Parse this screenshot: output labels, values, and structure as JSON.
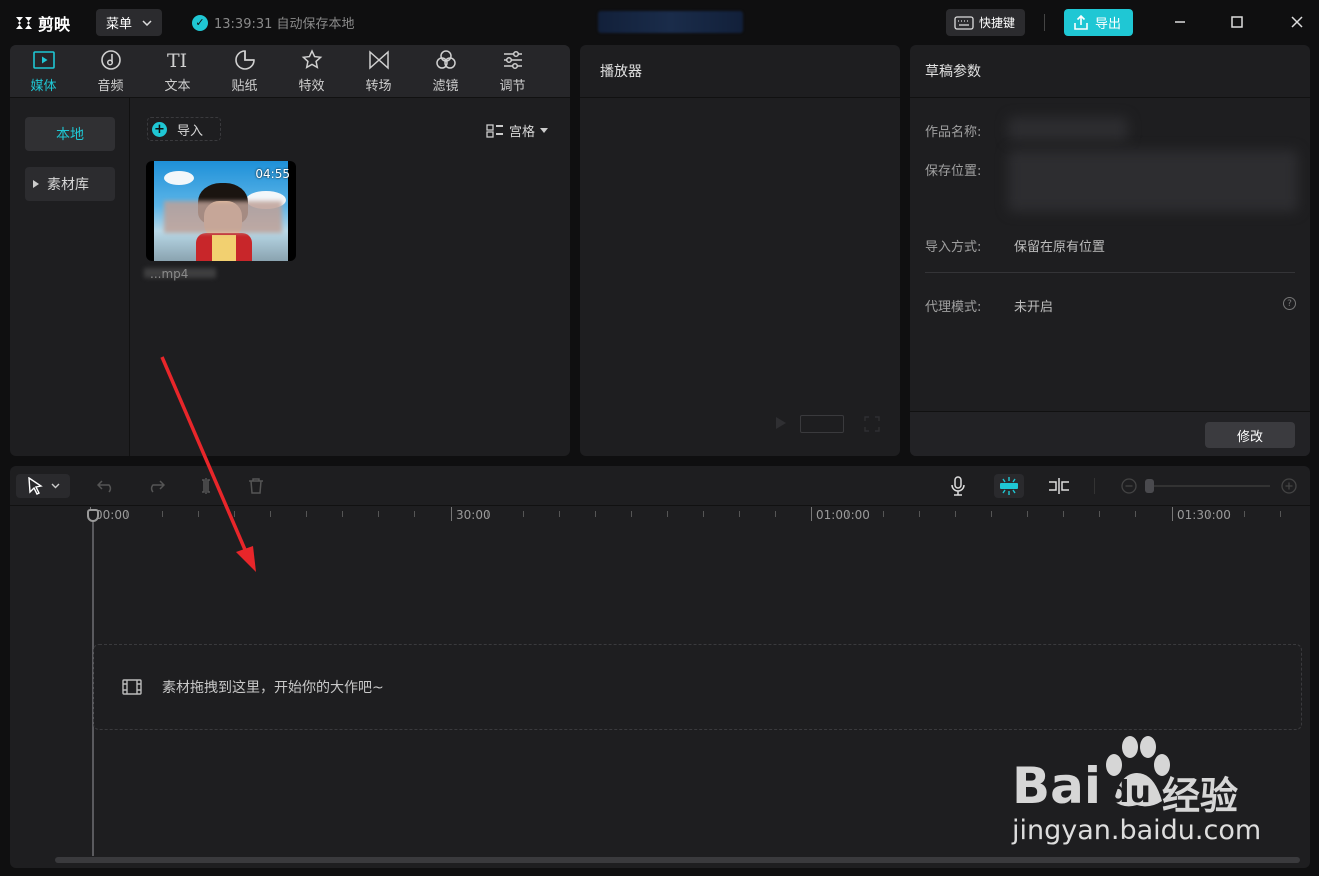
{
  "titlebar": {
    "app_name": "剪映",
    "menu_label": "菜单",
    "autosave_text": "13:39:31 自动保存本地",
    "shortcut_label": "快捷键",
    "export_label": "导出"
  },
  "media": {
    "tabs": [
      {
        "label": "媒体",
        "icon": "media-icon",
        "active": true
      },
      {
        "label": "音频",
        "icon": "audio-icon",
        "active": false
      },
      {
        "label": "文本",
        "icon": "text-icon",
        "active": false
      },
      {
        "label": "贴纸",
        "icon": "sticker-icon",
        "active": false
      },
      {
        "label": "特效",
        "icon": "effects-icon",
        "active": false
      },
      {
        "label": "转场",
        "icon": "transition-icon",
        "active": false
      },
      {
        "label": "滤镜",
        "icon": "filter-icon",
        "active": false
      },
      {
        "label": "调节",
        "icon": "adjust-icon",
        "active": false
      }
    ],
    "sidebar": [
      {
        "label": "本地",
        "active": true
      },
      {
        "label": "素材库",
        "active": false
      }
    ],
    "import_label": "导入",
    "view_label": "宫格",
    "clip": {
      "duration": "04:55",
      "name": "...mp4"
    }
  },
  "player": {
    "title": "播放器"
  },
  "draft": {
    "title": "草稿参数",
    "fields": [
      {
        "label": "作品名称:",
        "value": ""
      },
      {
        "label": "保存位置:",
        "value": ""
      },
      {
        "label": "导入方式:",
        "value": "保留在原有位置"
      },
      {
        "label": "代理模式:",
        "value": "未开启"
      }
    ],
    "modify_label": "修改"
  },
  "timeline": {
    "ruler": [
      "00:00",
      "30:00",
      "01:00:00",
      "01:30:00"
    ],
    "drop_hint": "素材拖拽到这里，开始你的大作吧~"
  },
  "watermark": {
    "brand": "Bai",
    "brand2": "du",
    "cn": "经验",
    "url": "jingyan.baidu.com"
  },
  "colors": {
    "accent": "#1fc7d4",
    "annotation_arrow": "#e8262a"
  }
}
